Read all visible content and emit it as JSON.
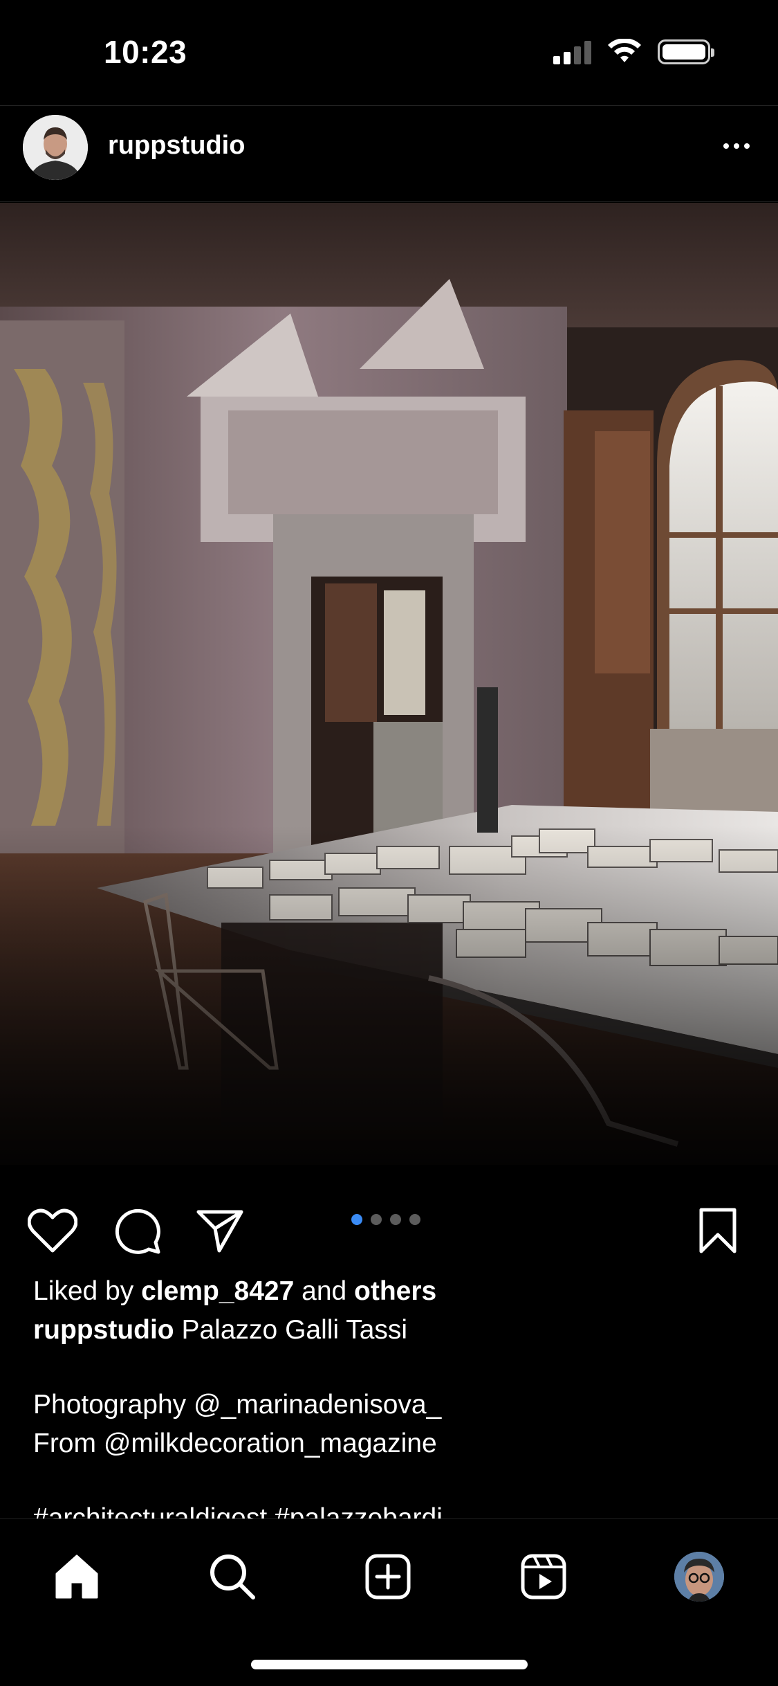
{
  "status_bar": {
    "time": "10:23"
  },
  "post": {
    "username": "ruppstudio",
    "carousel": {
      "count": 4,
      "active_index": 0
    },
    "liked_by_prefix": "Liked by",
    "liked_by_user": "clemp_8427",
    "liked_by_and": "and",
    "liked_by_others": "others",
    "caption_username": "ruppstudio",
    "caption_text": "Palazzo Galli Tassi",
    "caption_line_2": "Photography @_marinadenisova_",
    "caption_line_3": "From @milkdecoration_magazine",
    "caption_line_4": "#architecturaldigest #palazzobardi"
  },
  "icons": {
    "like": "heart-icon",
    "comment": "comment-bubble-icon",
    "share": "paper-plane-icon",
    "save": "bookmark-icon",
    "more": "ellipsis-icon"
  },
  "nav": {
    "items": [
      "home-icon",
      "search-icon",
      "create-post-icon",
      "reels-icon",
      "profile-avatar"
    ]
  },
  "colors": {
    "background": "#000000",
    "carousel_active": "#3a8bf5",
    "carousel_inactive": "#5c5c5c"
  }
}
